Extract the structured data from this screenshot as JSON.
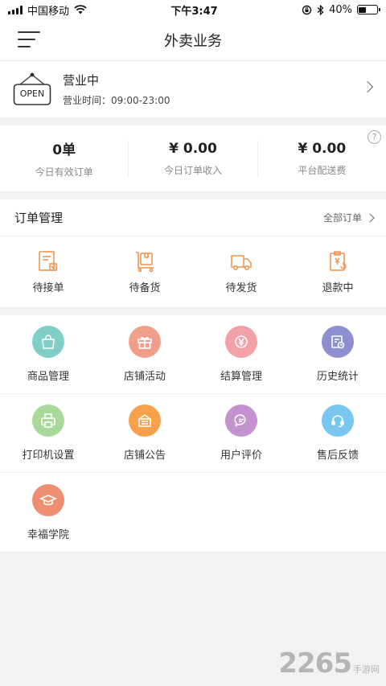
{
  "status_bar": {
    "carrier": "中国移动",
    "time": "下午3:47",
    "battery": "40%",
    "battery_level": 0.4
  },
  "nav": {
    "title": "外卖业务"
  },
  "store": {
    "sign_text": "OPEN",
    "status": "营业中",
    "hours": "营业时间：09:00-23:00"
  },
  "stats": [
    {
      "value": "0单",
      "label": "今日有效订单"
    },
    {
      "value": "¥ 0.00",
      "label": "今日订单收入"
    },
    {
      "value": "¥ 0.00",
      "label": "平台配送费"
    }
  ],
  "orders": {
    "title": "订单管理",
    "all_label": "全部订单",
    "items": [
      {
        "label": "待接单",
        "icon": "pending-accept-icon"
      },
      {
        "label": "待备货",
        "icon": "stocking-icon"
      },
      {
        "label": "待发货",
        "icon": "delivery-truck-icon"
      },
      {
        "label": "退款中",
        "icon": "refund-icon"
      }
    ]
  },
  "features": [
    {
      "label": "商品管理",
      "icon": "shopping-bag-icon",
      "color": "#7fcfc7"
    },
    {
      "label": "店铺活动",
      "icon": "gift-icon",
      "color": "#f0a08a"
    },
    {
      "label": "结算管理",
      "icon": "yen-icon",
      "color": "#f3a0a6"
    },
    {
      "label": "历史统计",
      "icon": "calendar-clock-icon",
      "color": "#8e8fd0"
    },
    {
      "label": "打印机设置",
      "icon": "printer-icon",
      "color": "#a8d89a"
    },
    {
      "label": "店铺公告",
      "icon": "announcement-icon",
      "color": "#f7a24a"
    },
    {
      "label": "用户评价",
      "icon": "chat-bubble-icon",
      "color": "#c493cf"
    },
    {
      "label": "售后反馈",
      "icon": "headset-icon",
      "color": "#79c6ee"
    },
    {
      "label": "幸福学院",
      "icon": "graduation-cap-icon",
      "color": "#ef8f72"
    }
  ],
  "watermark": {
    "number": "2265",
    "suffix": "手游网"
  },
  "colors": {
    "order_icon": "#f19149",
    "background": "#f2f2f2"
  }
}
